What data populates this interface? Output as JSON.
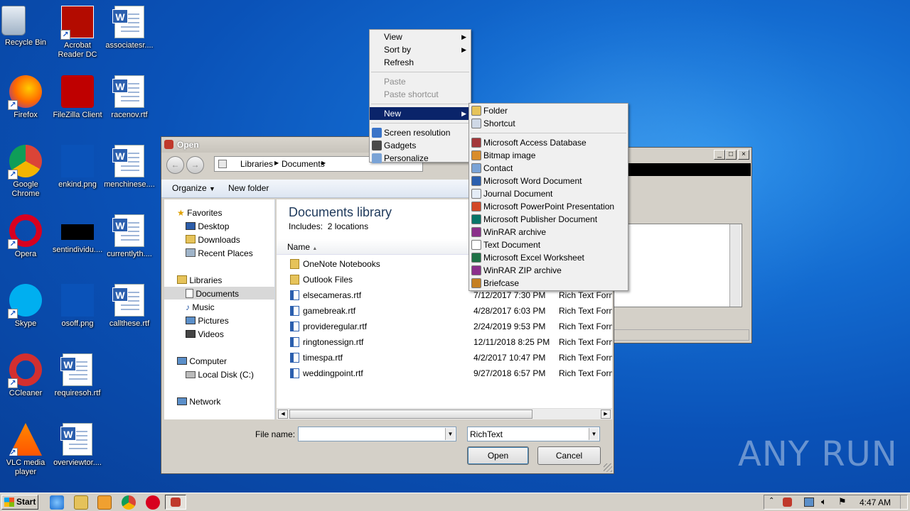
{
  "desktop": {
    "icons": [
      {
        "label": "Recycle Bin",
        "icon": "recycle-bin-icon"
      },
      {
        "label": "Acrobat Reader DC",
        "icon": "acrobat-icon"
      },
      {
        "label": "associatesr....",
        "icon": "word-doc-icon"
      },
      {
        "label": "Firefox",
        "icon": "firefox-icon"
      },
      {
        "label": "FileZilla Client",
        "icon": "filezilla-icon"
      },
      {
        "label": "racenov.rtf",
        "icon": "word-doc-icon"
      },
      {
        "label": "Google Chrome",
        "icon": "chrome-icon"
      },
      {
        "label": "enkind.png",
        "icon": "image-icon"
      },
      {
        "label": "menchinese....",
        "icon": "word-doc-icon"
      },
      {
        "label": "Opera",
        "icon": "opera-icon"
      },
      {
        "label": "sentindividu....",
        "icon": "image-icon"
      },
      {
        "label": "currentlyth....",
        "icon": "word-doc-icon"
      },
      {
        "label": "Skype",
        "icon": "skype-icon"
      },
      {
        "label": "osoff.png",
        "icon": "image-icon"
      },
      {
        "label": "callthese.rtf",
        "icon": "word-doc-icon"
      },
      {
        "label": "CCleaner",
        "icon": "ccleaner-icon"
      },
      {
        "label": "requiresoh.rtf",
        "icon": "word-doc-icon"
      },
      {
        "label": "VLC media player",
        "icon": "vlc-icon"
      },
      {
        "label": "overviewtor....",
        "icon": "word-doc-icon"
      }
    ]
  },
  "open_dialog": {
    "title": "Open",
    "breadcrumb": [
      "Libraries",
      "Documents"
    ],
    "toolbar": {
      "organize": "Organize",
      "new_folder": "New folder"
    },
    "nav": {
      "favorites": "Favorites",
      "favorites_items": [
        "Desktop",
        "Downloads",
        "Recent Places"
      ],
      "libraries": "Libraries",
      "libraries_items": [
        "Documents",
        "Music",
        "Pictures",
        "Videos"
      ],
      "computer": "Computer",
      "computer_items": [
        "Local Disk (C:)"
      ],
      "network": "Network"
    },
    "library_title": "Documents library",
    "includes": "Includes:  2 locations",
    "column_name": "Name",
    "files": [
      {
        "name": "OneNote Notebooks",
        "date": "",
        "type": "",
        "kind": "folder"
      },
      {
        "name": "Outlook Files",
        "date": "",
        "type": "",
        "kind": "folder"
      },
      {
        "name": "elsecameras.rtf",
        "date": "7/12/2017 7:30 PM",
        "type": "Rich Text Forma",
        "kind": "rtf"
      },
      {
        "name": "gamebreak.rtf",
        "date": "4/28/2017 6:03 PM",
        "type": "Rich Text Forma",
        "kind": "rtf"
      },
      {
        "name": "provideregular.rtf",
        "date": "2/24/2019 9:53 PM",
        "type": "Rich Text Forma",
        "kind": "rtf"
      },
      {
        "name": "ringtonessign.rtf",
        "date": "12/11/2018 8:25 PM",
        "type": "Rich Text Forma",
        "kind": "rtf"
      },
      {
        "name": "timespa.rtf",
        "date": "4/2/2017 10:47 PM",
        "type": "Rich Text Forma",
        "kind": "rtf"
      },
      {
        "name": "weddingpoint.rtf",
        "date": "9/27/2018 6:57 PM",
        "type": "Rich Text Forma",
        "kind": "rtf"
      }
    ],
    "file_name_label": "File name:",
    "file_name_value": "",
    "file_type_value": "RichText",
    "open_button": "Open",
    "cancel_button": "Cancel"
  },
  "context_menu": {
    "items": [
      {
        "label": "View",
        "submenu": true,
        "disabled": false
      },
      {
        "label": "Sort by",
        "submenu": true,
        "disabled": false
      },
      {
        "label": "Refresh",
        "submenu": false,
        "disabled": false
      },
      {
        "label": "Paste",
        "submenu": false,
        "disabled": true
      },
      {
        "label": "Paste shortcut",
        "submenu": false,
        "disabled": true
      },
      {
        "label": "New",
        "submenu": true,
        "disabled": false,
        "selected": true
      },
      {
        "label": "Screen resolution",
        "submenu": false,
        "disabled": false
      },
      {
        "label": "Gadgets",
        "submenu": false,
        "disabled": false
      },
      {
        "label": "Personalize",
        "submenu": false,
        "disabled": false
      }
    ]
  },
  "new_submenu": {
    "items": [
      {
        "label": "Folder",
        "icon": "folder-icon"
      },
      {
        "label": "Shortcut",
        "icon": "shortcut-icon"
      },
      {
        "label": "Microsoft Access Database",
        "icon": "access-icon"
      },
      {
        "label": "Bitmap image",
        "icon": "bitmap-icon"
      },
      {
        "label": "Contact",
        "icon": "contact-icon"
      },
      {
        "label": "Microsoft Word Document",
        "icon": "word-icon"
      },
      {
        "label": "Journal Document",
        "icon": "journal-icon"
      },
      {
        "label": "Microsoft PowerPoint Presentation",
        "icon": "powerpoint-icon"
      },
      {
        "label": "Microsoft Publisher Document",
        "icon": "publisher-icon"
      },
      {
        "label": "WinRAR archive",
        "icon": "winrar-icon"
      },
      {
        "label": "Text Document",
        "icon": "text-doc-icon"
      },
      {
        "label": "Microsoft Excel Worksheet",
        "icon": "excel-icon"
      },
      {
        "label": "WinRAR ZIP archive",
        "icon": "winrar-zip-icon"
      },
      {
        "label": "Briefcase",
        "icon": "briefcase-icon"
      }
    ]
  },
  "taskbar": {
    "start": "Start",
    "clock": "4:47 AM"
  },
  "watermark": "ANY RUN",
  "colors": {
    "desktop": "#0a52b8",
    "menu_highlight": "#0a246a",
    "dialog_face": "#d4d0c8"
  }
}
